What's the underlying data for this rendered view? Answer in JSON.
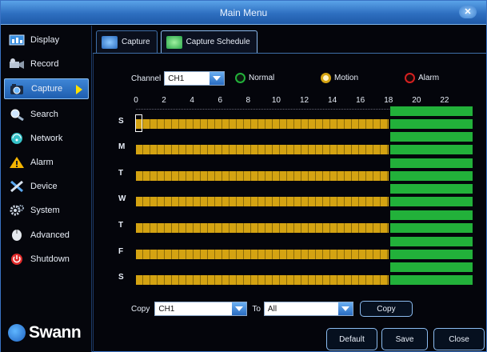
{
  "window": {
    "title": "Main Menu"
  },
  "sidebar": {
    "items": [
      {
        "label": "Display",
        "icon": "display-icon"
      },
      {
        "label": "Record",
        "icon": "record-icon"
      },
      {
        "label": "Capture",
        "icon": "capture-icon",
        "active": true
      },
      {
        "label": "Search",
        "icon": "search-icon"
      },
      {
        "label": "Network",
        "icon": "network-icon"
      },
      {
        "label": "Alarm",
        "icon": "alarm-icon"
      },
      {
        "label": "Device",
        "icon": "device-icon"
      },
      {
        "label": "System",
        "icon": "system-icon"
      },
      {
        "label": "Advanced",
        "icon": "advanced-icon"
      },
      {
        "label": "Shutdown",
        "icon": "shutdown-icon"
      }
    ],
    "logo": "Swann"
  },
  "tabs": [
    {
      "label": "Capture"
    },
    {
      "label": "Capture Schedule",
      "active": true
    }
  ],
  "channel": {
    "label": "Channel",
    "value": "CH1"
  },
  "legend": {
    "normal": {
      "label": "Normal",
      "color": "#22b13a"
    },
    "motion": {
      "label": "Motion",
      "color": "#d4a312"
    },
    "alarm": {
      "label": "Alarm",
      "color": "#d42020"
    }
  },
  "schedule": {
    "hours": [
      "0",
      "2",
      "4",
      "6",
      "8",
      "10",
      "12",
      "14",
      "16",
      "18",
      "20",
      "22"
    ],
    "days": [
      "S",
      "M",
      "T",
      "W",
      "T",
      "F",
      "S"
    ],
    "motion_hours": [
      0,
      18
    ],
    "normal_hours": [
      18,
      24
    ]
  },
  "copy": {
    "label": "Copy",
    "from_value": "CH1",
    "to_label": "To",
    "to_value": "All",
    "button": "Copy"
  },
  "buttons": {
    "default": "Default",
    "save": "Save",
    "close": "Close"
  }
}
